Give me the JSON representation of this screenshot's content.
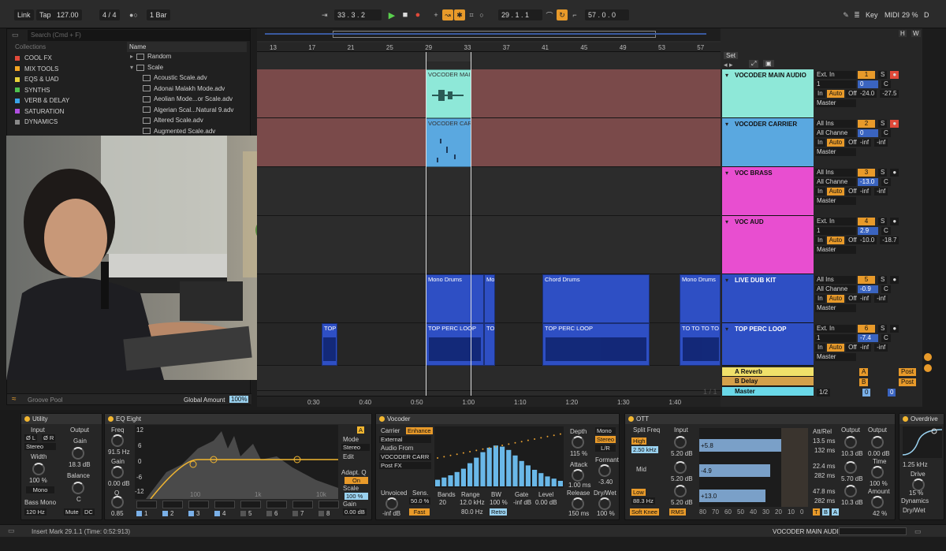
{
  "topbar": {
    "link": "Link",
    "tap": "Tap",
    "tempo": "127.00",
    "time_sig": "4 / 4",
    "quantize": "1 Bar",
    "position": "33 .  3 .  2",
    "loop_start": "29 .  1 .  1",
    "loop_length": "57 .  0 .  0",
    "key": "Key",
    "midi": "MIDI",
    "cpu": "29 %",
    "d": "D"
  },
  "browser": {
    "search_placeholder": "Search (Cmd + F)",
    "collections_header": "Collections",
    "collections": [
      {
        "label": "COOL FX",
        "color": "#e24a3a"
      },
      {
        "label": "MIX TOOLS",
        "color": "#f5a623"
      },
      {
        "label": "EQS & UAD",
        "color": "#e8d23a"
      },
      {
        "label": "SYNTHS",
        "color": "#4ec24e"
      },
      {
        "label": "VERB & DELAY",
        "color": "#3aa4e8"
      },
      {
        "label": "SATURATION",
        "color": "#b04ee0"
      },
      {
        "label": "DYNAMICS",
        "color": "#8a8a8a"
      }
    ],
    "name_header": "Name",
    "folders": [
      "Random",
      "Scale"
    ],
    "files": [
      "Acoustic Scale.adv",
      "Adonai Malakh Mode.adv",
      "Aeolian Mode...or Scale.adv",
      "Algerian Scal...Natural 9.adv",
      "Altered Scale.adv",
      "Augmented Scale.adv"
    ],
    "groove_pool": "Groove Pool",
    "global_amount_label": "Global Amount",
    "global_amount": "100%"
  },
  "arrangement": {
    "bars": [
      "13",
      "17",
      "21",
      "25",
      "29",
      "33",
      "37",
      "41",
      "45",
      "49",
      "53",
      "57"
    ],
    "times": [
      "0:30",
      "0:40",
      "0:50",
      "1:00",
      "1:10",
      "1:20",
      "1:30",
      "1:40"
    ],
    "set_label": "Set",
    "clips": {
      "vocoder_main": "VOCODER MAIN",
      "vocoder_carr": "VOCODER CARR",
      "mono_drums_1": "Mono Drums",
      "mono_drums_2": "Mo",
      "chord_drums": "Chord Drums",
      "mono_drums_3": "Mono Drums",
      "top_perc_1": "TOP PERC LOOP",
      "top_perc_2": "TO",
      "top_perc_3": "TOP PERC LOOP",
      "top_perc_4": "TO",
      "top_perc_5": "TO TO TO TO",
      "top_perc_left": "TOP PE",
      "fraction": "1 / 1"
    }
  },
  "tracks": [
    {
      "name": "VOCODER MAIN AUDIO",
      "color": "#8ee8d8",
      "input": "Ext. In",
      "channel": "1",
      "out": "Master",
      "num": "1",
      "vol": "0",
      "pan": "C",
      "l": "-24.0",
      "r": "-27.5"
    },
    {
      "name": "VOCODER CARRIER",
      "color": "#5aa8e0",
      "input": "All Ins",
      "channel": "All Channe",
      "out": "Master",
      "num": "2",
      "vol": "0",
      "pan": "C",
      "l": "-inf",
      "r": "-inf"
    },
    {
      "name": "VOC BRASS",
      "color": "#e84ed0",
      "input": "All Ins",
      "channel": "All Channe",
      "out": "Master",
      "num": "3",
      "vol": "-13.0",
      "pan": "C",
      "l": "-inf",
      "r": "-inf"
    },
    {
      "name": "VOC AUD",
      "color": "#e84ed0",
      "input": "Ext. In",
      "channel": "1",
      "out": "Master",
      "num": "4",
      "vol": "2.9",
      "pan": "C",
      "l": "-10.0",
      "r": "-18.7"
    },
    {
      "name": "LIVE DUB KIT",
      "color": "#2e4fc4",
      "input": "All Ins",
      "channel": "All Channe",
      "out": "Master",
      "num": "5",
      "vol": "-0.9",
      "pan": "C",
      "l": "-inf",
      "r": "-inf"
    },
    {
      "name": "TOP PERC LOOP",
      "color": "#2e4fc4",
      "input": "Ext. In",
      "channel": "1",
      "out": "Master",
      "num": "6",
      "vol": "-7.4",
      "pan": "C",
      "l": "-inf",
      "r": "-inf"
    }
  ],
  "returns": [
    {
      "name": "A Reverb",
      "color": "#f0e06a",
      "letter": "A",
      "post": "Post"
    },
    {
      "name": "B Delay",
      "color": "#d4a04a",
      "letter": "B",
      "post": "Post"
    }
  ],
  "master": {
    "name": "Master",
    "color": "#6ad8e8",
    "out": "1/2",
    "vol": "0",
    "pan": "0"
  },
  "io_labels": {
    "in": "In",
    "auto": "Auto",
    "off": "Off",
    "s": "S"
  },
  "devices": {
    "utility": {
      "title": "Utility",
      "input": "Input",
      "output": "Output",
      "phase_l": "Ø L",
      "phase_r": "Ø R",
      "stereo": "Stereo",
      "width_label": "Width",
      "width": "100 %",
      "mono": "Mono",
      "gain_label": "Gain",
      "gain": "18.3 dB",
      "balance_label": "Balance",
      "balance": "C",
      "bass_mono": "Bass Mono",
      "bass_freq": "120 Hz",
      "mute": "Mute",
      "dc": "DC"
    },
    "eq": {
      "title": "EQ Eight",
      "freq_label": "Freq",
      "freq": "91.5 Hz",
      "gain_label": "Gain",
      "gain": "0.00 dB",
      "q_label": "Q",
      "q": "0.85",
      "ylabels": [
        "12",
        "6",
        "0",
        "-6",
        "-12"
      ],
      "xlabels": [
        "100",
        "1k",
        "10k"
      ],
      "mode_label": "Mode",
      "mode": "Stereo",
      "edit": "Edit",
      "adapt_q": "Adapt. Q",
      "on": "On",
      "scale_label": "Scale",
      "scale": "100 %",
      "out_gain_label": "Gain",
      "out_gain": "0.00 dB",
      "bands": [
        "1",
        "2",
        "3",
        "4",
        "5",
        "6",
        "7",
        "8"
      ],
      "aa": "A"
    },
    "vocoder": {
      "title": "Vocoder",
      "carrier_label": "Carrier",
      "enhance": "Enhance",
      "carrier": "External",
      "audio_from_label": "Audio From",
      "audio_from": "VOCODER CARR",
      "post_fx": "Post FX",
      "unvoiced_label": "Unvoiced",
      "unvoiced": "-inf dB",
      "sens_label": "Sens.",
      "sens": "50.0 %",
      "fast": "Fast",
      "bands_label": "Bands",
      "bands": "20",
      "range_label": "Range",
      "range_lo": "12.0 kHz",
      "range_hi": "80.0 Hz",
      "bw_label": "BW",
      "bw": "100 %",
      "gate_label": "Gate",
      "gate": "-inf dB",
      "level_label": "Level",
      "level": "0.00 dB",
      "retro": "Retro",
      "depth_label": "Depth",
      "depth": "115 %",
      "attack_label": "Attack",
      "attack": "1.00 ms",
      "release_label": "Release",
      "release": "150 ms",
      "mono": "Mono",
      "stereo": "Stereo",
      "lr": "L/R",
      "formant_label": "Formant",
      "formant": "-3.40",
      "drywet_label": "Dry/Wet",
      "drywet": "100 %",
      "bar_heights": [
        0.12,
        0.16,
        0.2,
        0.26,
        0.32,
        0.42,
        0.52,
        0.62,
        0.7,
        0.74,
        0.72,
        0.66,
        0.56,
        0.46,
        0.38,
        0.3,
        0.24,
        0.18,
        0.14,
        0.1
      ]
    },
    "ott": {
      "title": "OTT",
      "split_label": "Split Freq",
      "high": "High",
      "high_freq": "2.50 kHz",
      "mid": "Mid",
      "low": "Low",
      "low_freq": "88.3 Hz",
      "soft_knee": "Soft Knee",
      "rms": "RMS",
      "input_label": "Input",
      "in1": "5.20 dB",
      "in2": "5.20 dB",
      "in3": "5.20 dB",
      "meter1": "+5.8",
      "meter2": "-4.9",
      "meter3": "+13.0",
      "axis": [
        "80",
        "70",
        "60",
        "50",
        "40",
        "30",
        "20",
        "10",
        "0"
      ],
      "attrel_label": "Att/Rel",
      "a1": "13.5 ms",
      "r1": "132 ms",
      "a2": "22.4 ms",
      "r2": "282 ms",
      "a3": "47.8 ms",
      "r3": "282 ms",
      "output_label": "Output",
      "o1": "10.3 dB",
      "o2": "5.70 dB",
      "o3": "10.3 dB",
      "output2_label": "Output",
      "o_main": "0.00 dB",
      "time_label": "Time",
      "time": "100 %",
      "amount_label": "Amount",
      "amount": "42 %",
      "t": "T",
      "b": "B",
      "a": "A"
    },
    "overdrive": {
      "title": "Overdrive",
      "drive": "1.25 kHz",
      "drive_label": "Drive",
      "dynamics_label": "Dynamics",
      "drywet_label": "Dry/Wet",
      "dynamics": "15 %"
    }
  },
  "status": {
    "text": "Insert Mark 29.1.1 (Time: 0:52:913)",
    "track": "VOCODER MAIN AUDIO"
  }
}
